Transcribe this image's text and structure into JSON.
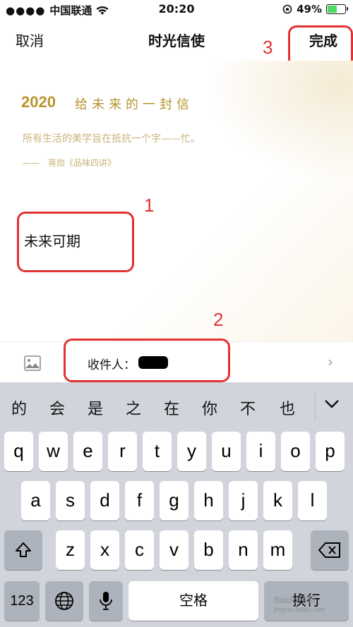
{
  "status_bar": {
    "carrier": "中国联通",
    "time": "20:20",
    "battery": "49%",
    "battery_level": 0.49
  },
  "nav": {
    "cancel": "取消",
    "title": "时光信使",
    "done": "完成"
  },
  "annotations": {
    "n1": "1",
    "n2": "2",
    "n3": "3"
  },
  "letter": {
    "year": "2020",
    "heading": "给未来的一封信",
    "quote": "所有生活的美学旨在抵抗一个字——忙。",
    "quote_author": "——　蒋勋《品味四讲》",
    "body": "未来可期"
  },
  "recipient": {
    "label": "收件人："
  },
  "keyboard": {
    "suggestions": [
      "的",
      "会",
      "是",
      "之",
      "在",
      "你",
      "不",
      "也"
    ],
    "row1": [
      "q",
      "w",
      "e",
      "r",
      "t",
      "y",
      "u",
      "i",
      "o",
      "p"
    ],
    "row2": [
      "a",
      "s",
      "d",
      "f",
      "g",
      "h",
      "j",
      "k",
      "l"
    ],
    "row3": [
      "z",
      "x",
      "c",
      "v",
      "b",
      "n",
      "m"
    ],
    "numbers_key": "123",
    "space": "空格",
    "return": "换行"
  },
  "watermark": {
    "main": "Baidu经验",
    "sub": "jingyan.baidu.com"
  }
}
